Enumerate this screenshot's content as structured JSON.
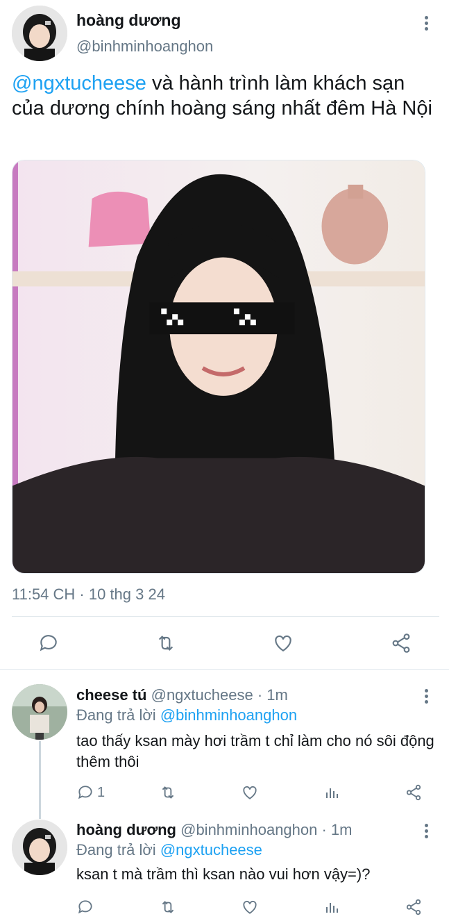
{
  "main_tweet": {
    "author_name": "hoàng dương",
    "author_handle": "@binhminhoanghon",
    "text_mention": "@ngxtucheese",
    "text_body": " và hành trình làm khách sạn của dương chính hoàng sáng nhất đêm Hà Nội",
    "timestamp": "11:54 CH · 10 thg 3 24",
    "actions": [
      "reply-icon",
      "retweet-icon",
      "like-icon",
      "share-icon"
    ]
  },
  "replies": [
    {
      "author_name": "cheese tú",
      "meta": " @ngxtucheese · 1m",
      "replying_prefix": "Đang trả lời ",
      "replying_to": "@binhminhoanghon",
      "text": "tao thấy ksan mày hơi trầm t chỉ làm cho nó sôi động thêm thôi",
      "reply_count": "1"
    },
    {
      "author_name": "hoàng dương",
      "meta": " @binhminhoanghon · 1m",
      "replying_prefix": "Đang trả lời ",
      "replying_to": "@ngxtucheese",
      "text": "ksan t mà trầm thì ksan nào vui hơn vậy=)?",
      "reply_count": ""
    }
  ],
  "colors": {
    "accent": "#1da1f2",
    "secondary_text": "#657786",
    "divider": "#e1e8ed"
  }
}
